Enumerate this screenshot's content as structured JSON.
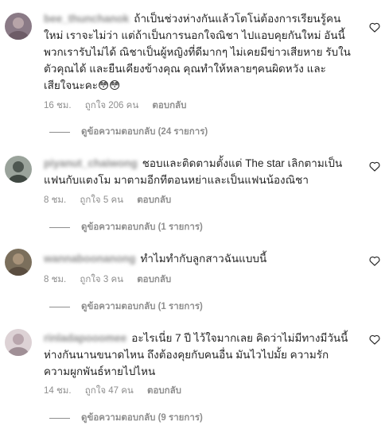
{
  "comments": [
    {
      "username": "bee_thunchanok",
      "text": "ถ้าเป็นช่วงห่างกันแล้วโตโน่ต้องการเรียนรู้คนใหม่ เราจะไม่ว่า แต่ถ้าเป็นการนอกใจณิชา ไปแอบคุยกันใหม่ อันนี้พวกเรารับไม่ได้ ณิชาเป็นผู้หญิงที่ดีมากๆ ไม่เคยมีข่าวเสียหาย รับในตัวคุณได้ และยืนเคียงข้างคุณ คุณทำให้หลายๆคนผิดหวัง และเสียใจนะคะ😳😳",
      "time": "16 ชม.",
      "likes": "ถูกใจ 206 คน",
      "reply": "ตอบกลับ",
      "view_replies": "ดูข้อความตอบกลับ (24 รายการ)",
      "avatar_color": "#8a7a86"
    },
    {
      "username": "piyanut_chaiwong",
      "text": "ชอบและติดตามตั้งแต่ The star เลิกตามเป็นแฟนกับแตงโม มาตามอีกทีตอนหย่าและเป็นแฟนน้องณิชา",
      "time": "8 ชม.",
      "likes": "ถูกใจ 5 คน",
      "reply": "ตอบกลับ",
      "view_replies": "ดูข้อความตอบกลับ (1 รายการ)",
      "avatar_color": "#5f6a62"
    },
    {
      "username": "wannaboonanong",
      "text": "ทำไมทำกับลูกสาวฉันแบบนี้",
      "time": "8 ชม.",
      "likes": "ถูกใจ 3 คน",
      "reply": "ตอบกลับ",
      "view_replies": "ดูข้อความตอบกลับ (1 รายการ)",
      "avatar_color": "#7b6f5c"
    },
    {
      "username": "rinladapooomee",
      "text": "อะไรเนี่ย 7 ปี ไว้ใจมากเลย คิดว่าไม่มีทางมีวันนี้ ห่างกันนานขนาดไหน ถึงต้องคุยกับคนอื่น มันไวไปมั้ย ความรักความผูกพันธ์หายไปไหน",
      "time": "14 ชม.",
      "likes": "ถูกใจ 47 คน",
      "reply": "ตอบกลับ",
      "view_replies": "ดูข้อความตอบกลับ (9 รายการ)",
      "avatar_color": "#cdbfc4"
    }
  ],
  "colors": {
    "text": "#262626",
    "muted": "#8e8e8e"
  },
  "icons": {
    "like": "heart-icon"
  }
}
